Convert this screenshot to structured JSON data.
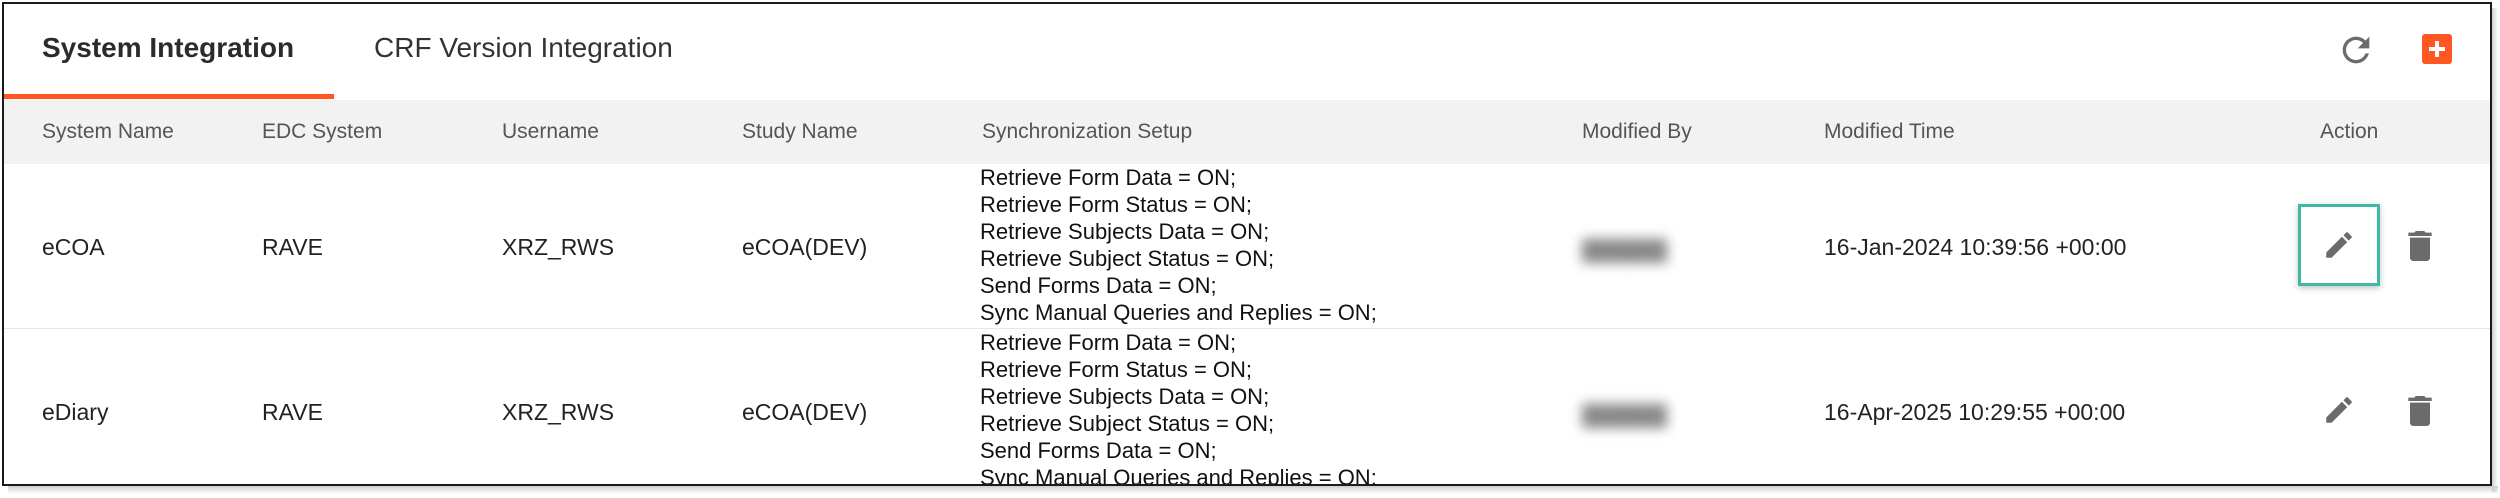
{
  "tabs": [
    {
      "label": "System Integration",
      "active": true
    },
    {
      "label": "CRF Version Integration",
      "active": false
    }
  ],
  "icons": {
    "refresh": "refresh-icon",
    "add": "add-icon",
    "edit": "pencil-icon",
    "delete": "trash-icon"
  },
  "colors": {
    "accent": "#ff5722",
    "focus_border": "#3fb8a6",
    "header_bg": "#f2f2f2",
    "icon_gray": "#6b6b6b"
  },
  "table": {
    "columns": [
      "System Name",
      "EDC System",
      "Username",
      "Study Name",
      "Synchronization Setup",
      "Modified By",
      "Modified Time",
      "Action"
    ],
    "rows": [
      {
        "system_name": "eCOA",
        "edc_system": "RAVE",
        "username": "XRZ_RWS",
        "study_name": "eCOA(DEV)",
        "sync_setup": [
          "Retrieve Form Data = ON;",
          "Retrieve Form Status = ON;",
          "Retrieve Subjects Data = ON;",
          "Retrieve Subject Status = ON;",
          "Send Forms Data = ON;",
          "Sync Manual Queries and Replies = ON;"
        ],
        "modified_time": "16-Jan-2024 10:39:56 +00:00"
      },
      {
        "system_name": "eDiary",
        "edc_system": "RAVE",
        "username": "XRZ_RWS",
        "study_name": "eCOA(DEV)",
        "sync_setup": [
          "Retrieve Form Data = ON;",
          "Retrieve Form Status = ON;",
          "Retrieve Subjects Data = ON;",
          "Retrieve Subject Status = ON;",
          "Send Forms Data = ON;",
          "Sync Manual Queries and Replies = ON;"
        ],
        "modified_time": "16-Apr-2025 10:29:55 +00:00"
      }
    ]
  }
}
